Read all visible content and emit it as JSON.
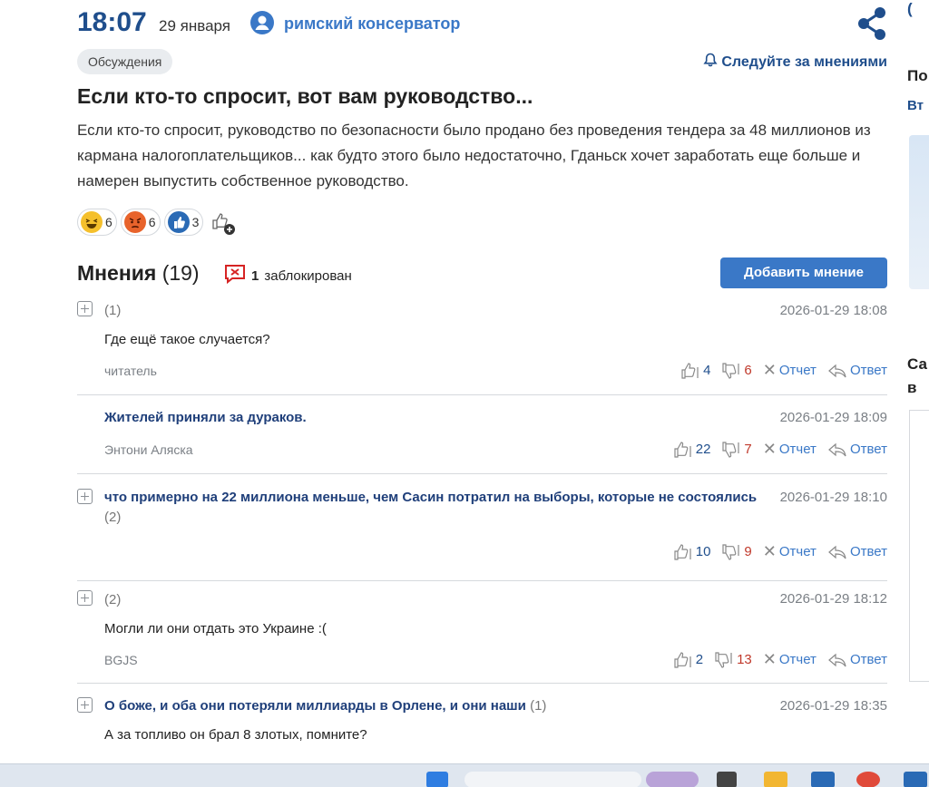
{
  "header": {
    "time": "18:07",
    "date": "29 января",
    "author": "римский консерватор"
  },
  "tag": "Обсуждения",
  "follow_label": "Следуйте за мнениями",
  "article": {
    "title": "Если кто-то спросит, вот вам руководство...",
    "lead": "Если кто-то спросит, руководство по безопасности было продано без проведения тендера за 48 миллионов из кармана налогоплательщиков... как будто этого было недостаточно, Гданьск хочет заработать еще больше и намерен выпустить собственное руководство."
  },
  "reactions": [
    {
      "icon": "laughing-face-icon",
      "count": "6",
      "color": "#f5c02c"
    },
    {
      "icon": "angry-face-icon",
      "count": "6",
      "color": "#e8632b"
    },
    {
      "icon": "thumbs-up-icon",
      "count": "3",
      "color": "#2a6ab5"
    }
  ],
  "opinions": {
    "label": "Мнения",
    "count": "(19)",
    "blocked_count": "1",
    "blocked_label": "заблокирован",
    "add_button": "Добавить мнение"
  },
  "actions": {
    "report": "Отчет",
    "reply": "Ответ"
  },
  "comments": [
    {
      "count": "(1)",
      "date": "2026-01-29 18:08",
      "text": "Где ещё такое случается?",
      "user": "читатель",
      "up": "4",
      "down": "6"
    },
    {
      "title": "Жителей приняли за дураков.",
      "date": "2026-01-29 18:09",
      "user": "Энтони Аляска",
      "up": "22",
      "down": "7"
    },
    {
      "title": "что примерно на 22 миллиона меньше, чем Сасин потратил на выборы, которые не состоялись",
      "sub": "(2)",
      "date": "2026-01-29 18:10",
      "up": "10",
      "down": "9"
    },
    {
      "count": "(2)",
      "date": "2026-01-29 18:12",
      "text": "Могли ли они отдать это Украине :(",
      "user": "BGJS",
      "up": "2",
      "down": "13"
    },
    {
      "title": "О боже, и оба они потеряли миллиарды в Орлене, и они наши",
      "sub": "(1)",
      "date": "2026-01-29 18:35",
      "text": "А за топливо он брал 8 злотых, помните?"
    }
  ],
  "rail": {
    "t1": "(",
    "t2": "По",
    "t3": "Вт",
    "t4": "Са",
    "t5": "в"
  },
  "colors": {
    "accent": "#3a78c7",
    "dark_blue": "#1f4e8c",
    "down_red": "#c0392b"
  }
}
